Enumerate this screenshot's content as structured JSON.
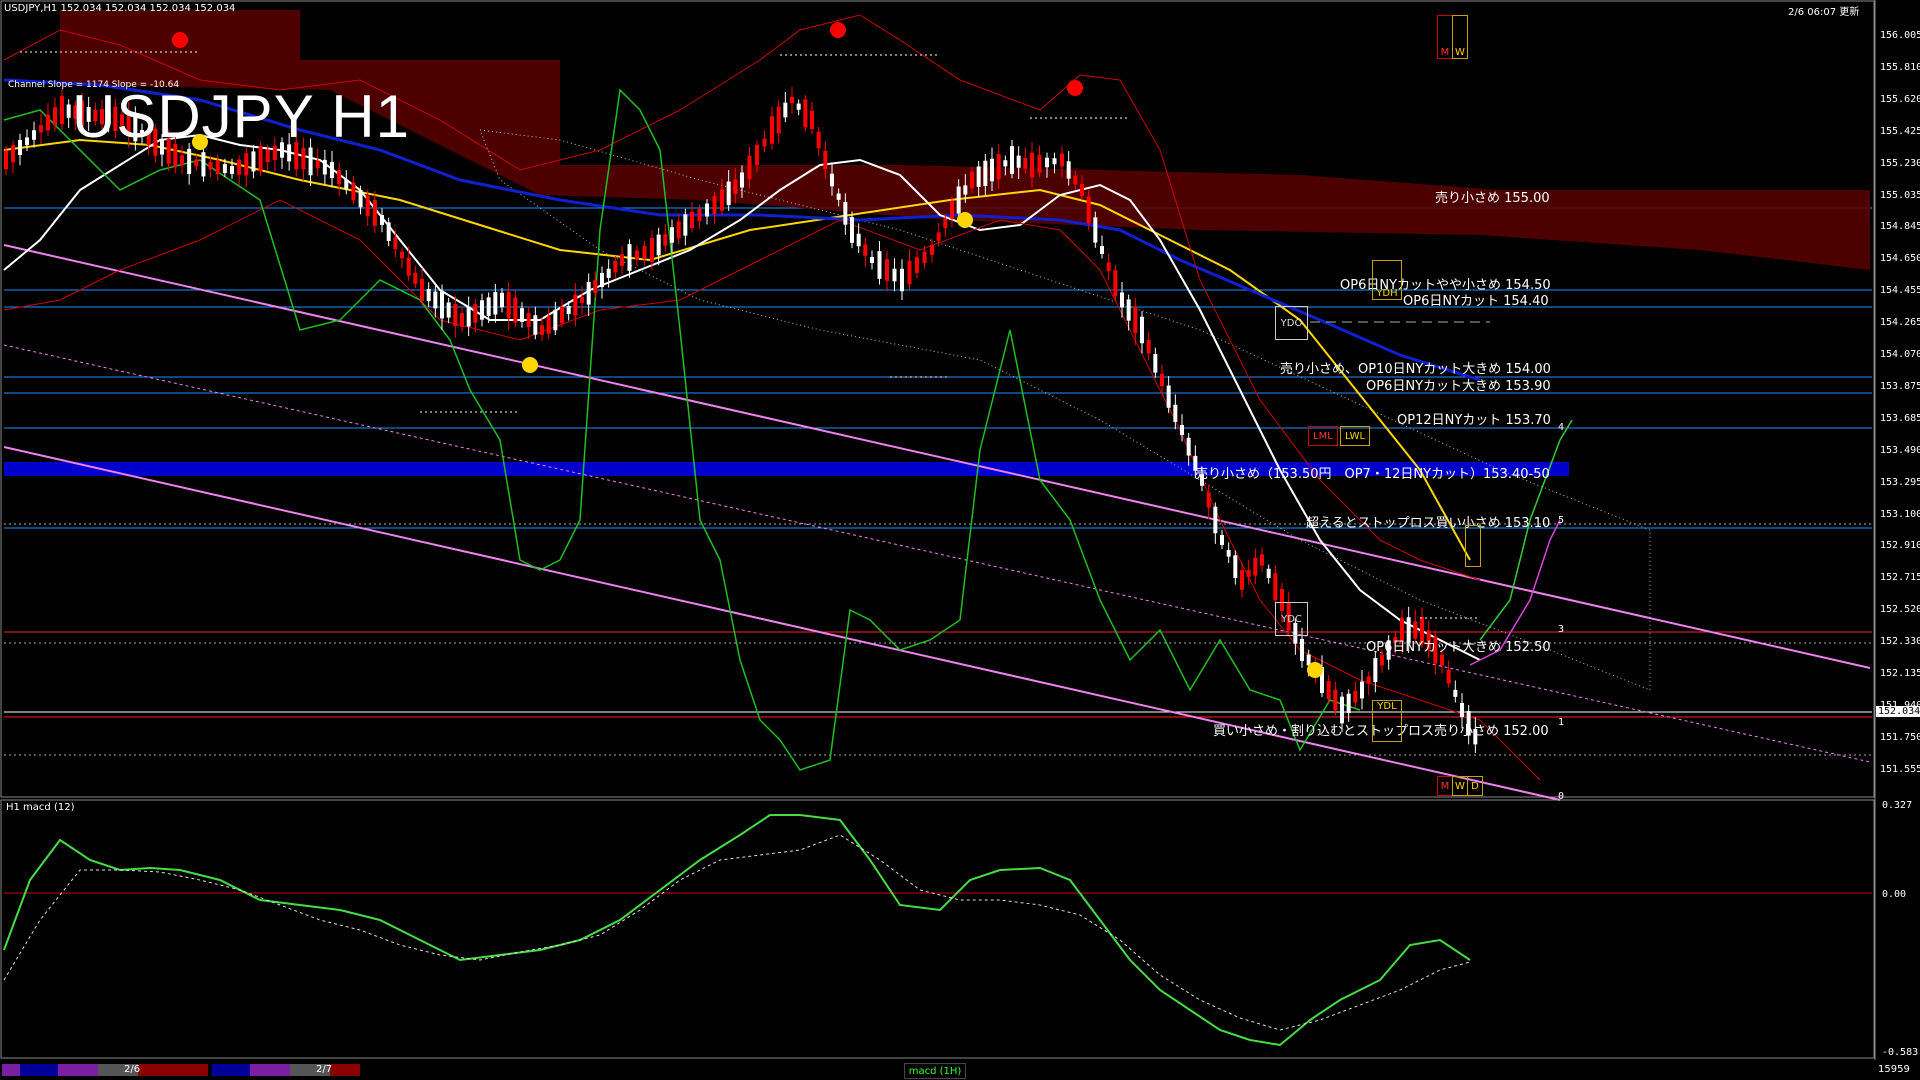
{
  "header": {
    "symbol_info": "USDJPY,H1  152.034 152.034 152.034 152.034",
    "datetime": "2/6 06:07 更新",
    "channel_info": "Channel Slope = 1174 Slope = -10.64"
  },
  "title": "USDJPY H1",
  "price_axis": [
    "156.005",
    "155.810",
    "155.620",
    "155.425",
    "155.230",
    "155.035",
    "154.845",
    "154.650",
    "154.455",
    "154.265",
    "154.070",
    "153.875",
    "153.685",
    "153.490",
    "153.295",
    "153.100",
    "152.910",
    "152.715",
    "152.520",
    "152.330",
    "152.135",
    "151.940",
    "151.750",
    "151.555"
  ],
  "current_price": "152.034",
  "macd": {
    "label": "H1  macd (12)",
    "top": "0.327",
    "zero": "0.00",
    "bottom": "-0.583",
    "tab": "macd (1H)"
  },
  "levels": [
    {
      "text": "売り小さめ 155.00"
    },
    {
      "text": "OP6日NYカットやや小さめ 154.50"
    },
    {
      "text": "OP6日NYカット 154.40"
    },
    {
      "text": "売り小さめ、OP10日NYカット大きめ 154.00"
    },
    {
      "text": "OP6日NYカット大きめ 153.90"
    },
    {
      "text": "OP12日NYカット 153.70"
    },
    {
      "text": "売り小さめ（153.50円　OP7・12日NYカット）153.40-50"
    },
    {
      "text": "超えるとストップロス買い小さめ 153.10"
    },
    {
      "text": "OP6日NYカット大きめ 152.50"
    },
    {
      "text": "買い小さめ・割り込むとストップロス売り小さめ 152.00"
    }
  ],
  "boxes": {
    "ydo": "YDO",
    "ydc": "YDC",
    "ydh": "YDH",
    "ydl": "YDL",
    "lml": "LML",
    "lwl": "LWL",
    "m": "M",
    "w": "W",
    "d": "D"
  },
  "fib": [
    "4",
    "5",
    "3",
    "1",
    "0"
  ],
  "bottom": {
    "date1": "2/6",
    "date2": "2/7",
    "right_num": "15959"
  },
  "colors": {
    "background": "#000000",
    "grid": "#1e90ff",
    "bull": "#ffffff",
    "bear": "#ff0000",
    "channel": "#ee82ee",
    "band_blue": "#0000cd"
  }
}
